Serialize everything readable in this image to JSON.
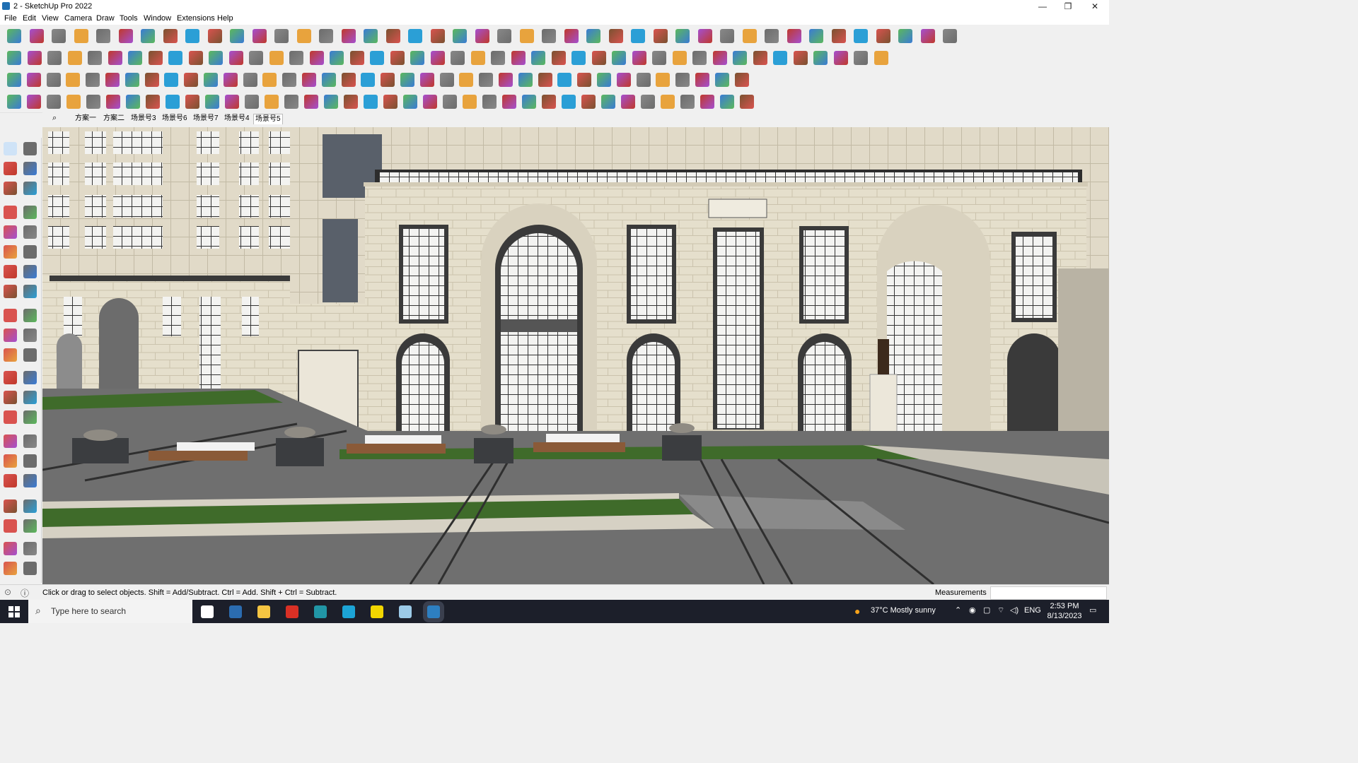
{
  "window": {
    "title": "2 - SketchUp Pro 2022",
    "minimize": "—",
    "maximize": "❐",
    "close": "✕"
  },
  "menu": [
    "File",
    "Edit",
    "View",
    "Camera",
    "Draw",
    "Tools",
    "Window",
    "Extensions",
    "Help"
  ],
  "scenes": {
    "search_icon": "search-icon",
    "tabs": [
      "方案一",
      "方案二",
      "场景号3",
      "场景号6",
      "场景号7",
      "场景号4",
      "场景号5"
    ],
    "active": "场景号5"
  },
  "status": {
    "hint": "Click or drag to select objects. Shift = Add/Subtract. Ctrl = Add. Shift + Ctrl = Subtract.",
    "measurements_label": "Measurements",
    "measurements_value": ""
  },
  "taskbar": {
    "search_placeholder": "Type here to search",
    "weather": "37°C  Mostly sunny",
    "language": "ENG",
    "time": "2:53 PM",
    "date": "8/13/2023"
  },
  "colors": {
    "accent_blue": "#1f6fb2",
    "taskbar_bg": "#1c1f2a",
    "facade": "#e6dfcd",
    "window_glass": "#f4f4f2",
    "grass": "#3f6b2a",
    "paving": "#6e6e6e"
  }
}
